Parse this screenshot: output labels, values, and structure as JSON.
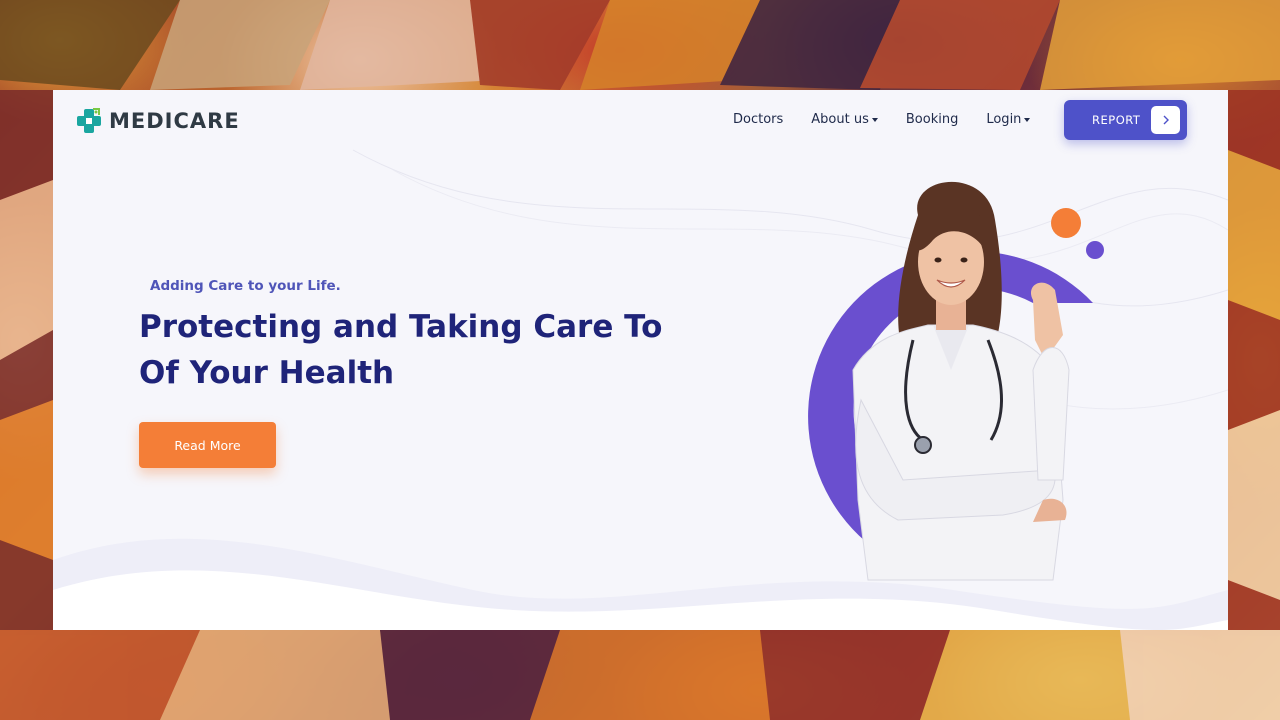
{
  "brand": {
    "name": "MEDICARE"
  },
  "nav": {
    "items": [
      {
        "label": "Doctors",
        "dropdown": false
      },
      {
        "label": "About us",
        "dropdown": true
      },
      {
        "label": "Booking",
        "dropdown": false
      },
      {
        "label": "Login",
        "dropdown": true
      }
    ],
    "report_label": "REPORT"
  },
  "hero": {
    "tagline": "Adding Care to your Life.",
    "headline_line1": "Protecting and Taking Care To",
    "headline_line2": "Of Your Health",
    "cta_label": "Read More"
  },
  "icons": {
    "logo": "medical-cross-icon",
    "report_arrow": "chevron-right-icon",
    "dropdown": "caret-down-icon"
  },
  "colors": {
    "primary": "#4e52c9",
    "headline": "#1f2479",
    "accent_orange": "#f47e37",
    "ring": "#6a4fcf",
    "page_bg": "#f6f6fb"
  }
}
